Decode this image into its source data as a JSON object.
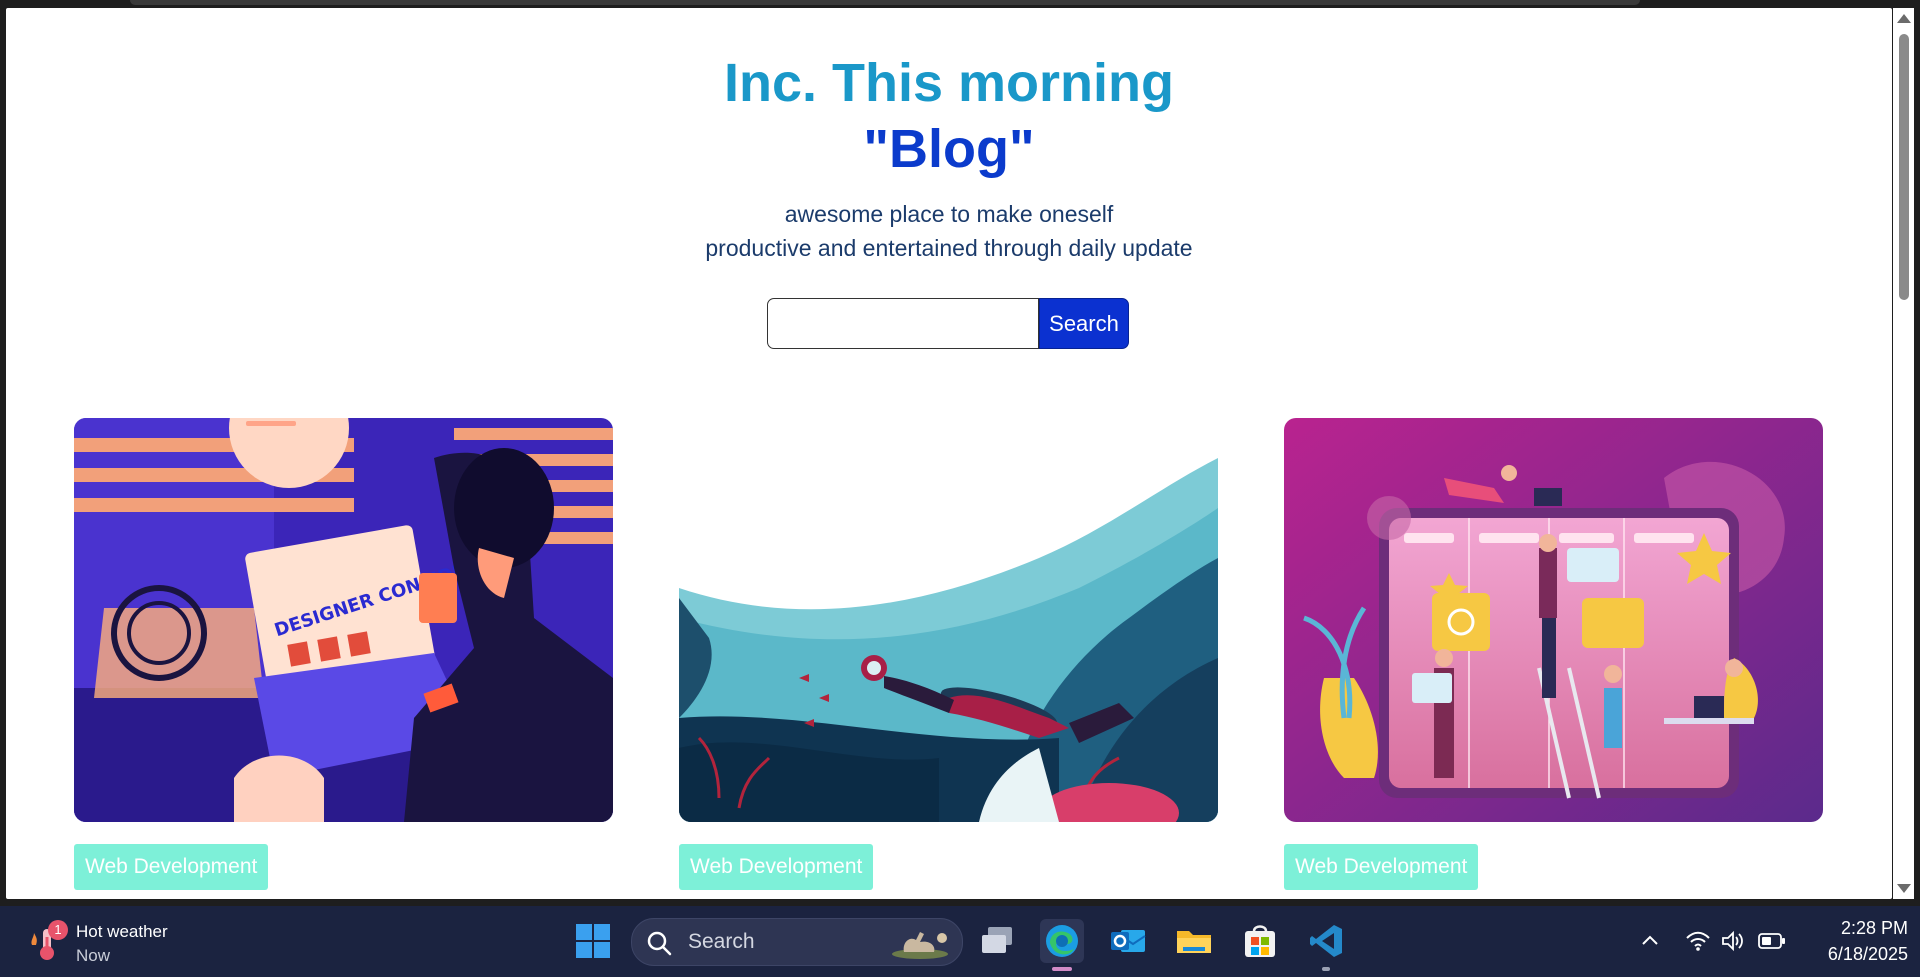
{
  "hero": {
    "title_line1": "Inc. This morning",
    "title_line2": "\"Blog\"",
    "tagline_line1": "awesome place to make oneself",
    "tagline_line2": "productive and entertained through daily update"
  },
  "search": {
    "placeholder": "",
    "value": "",
    "button_label": "Search"
  },
  "cards": [
    {
      "image": "designer-at-laptop-illustration",
      "image_text": "DESIGNER CONFIDENTIAL",
      "tag": "Web Development"
    },
    {
      "image": "scuba-diver-underwater-illustration",
      "tag": "Web Development"
    },
    {
      "image": "team-kanban-board-illustration",
      "tag": "Web Development"
    }
  ],
  "taskbar": {
    "weather": {
      "title": "Hot weather",
      "subtitle": "Now",
      "badge": "1"
    },
    "search_label": "Search",
    "apps": [
      "start-icon",
      "task-view-icon",
      "edge-icon",
      "outlook-icon",
      "file-explorer-icon",
      "microsoft-store-icon",
      "vscode-icon"
    ],
    "tray_icons": [
      "chevron-up-icon",
      "wifi-icon",
      "volume-icon",
      "battery-icon"
    ],
    "time": "2:28 PM",
    "date": "6/18/2025"
  },
  "colors": {
    "title_cyan": "#1a98c9",
    "title_blue": "#0b3bcc",
    "search_button": "#0b31d0",
    "tag_bg": "#7df0d8",
    "taskbar_bg": "#1b2340"
  }
}
